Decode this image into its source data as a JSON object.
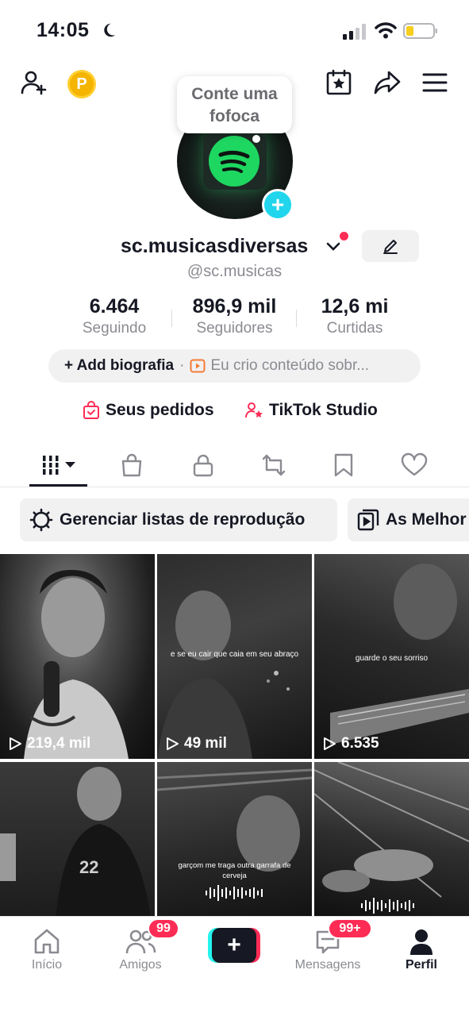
{
  "status_bar": {
    "time": "14:05"
  },
  "bubble": {
    "line1": "Conte uma",
    "line2": "fofoca"
  },
  "profile": {
    "display_name": "sc.musicasdiversas",
    "handle": "@sc.musicas"
  },
  "stats": [
    {
      "value": "6.464",
      "label": "Seguindo"
    },
    {
      "value": "896,9 mil",
      "label": "Seguidores"
    },
    {
      "value": "12,6 mi",
      "label": "Curtidas"
    }
  ],
  "bio": {
    "add_label": "+ Add biografia",
    "separator": "·",
    "text": "Eu crio conteúdo sobr..."
  },
  "links": {
    "orders": "Seus pedidos",
    "studio": "TikTok Studio"
  },
  "playlists": {
    "manage": "Gerenciar listas de reprodução",
    "best": "As Melhor"
  },
  "videos": [
    {
      "views": "219,4 mil",
      "caption": ""
    },
    {
      "views": "49 mil",
      "caption": "e se eu cair que caia em seu abraço"
    },
    {
      "views": "6.535",
      "caption": "guarde o seu sorriso"
    },
    {
      "views": "",
      "caption": ""
    },
    {
      "views": "",
      "caption": "garçom me traga outra garrafa de cerveja"
    },
    {
      "views": "",
      "caption": ""
    }
  ],
  "bottom_nav": {
    "home": "Início",
    "friends": "Amigos",
    "friends_badge": "99",
    "messages": "Mensagens",
    "messages_badge": "99+",
    "profile": "Perfil"
  },
  "colors": {
    "accent": "#fe2c55",
    "cyan": "#20d5ec",
    "spotify": "#1ed760",
    "coin": "#f4b400"
  },
  "icons": [
    "add-friend-icon",
    "coin-icon",
    "calendar-star-icon",
    "share-icon",
    "menu-icon",
    "edit-icon",
    "grid-icon",
    "shop-icon",
    "lock-icon",
    "repost-icon",
    "bookmark-icon",
    "heart-icon",
    "gear-icon",
    "playlist-icon",
    "play-icon",
    "home-icon",
    "friends-icon",
    "plus-icon",
    "message-icon",
    "person-icon"
  ]
}
